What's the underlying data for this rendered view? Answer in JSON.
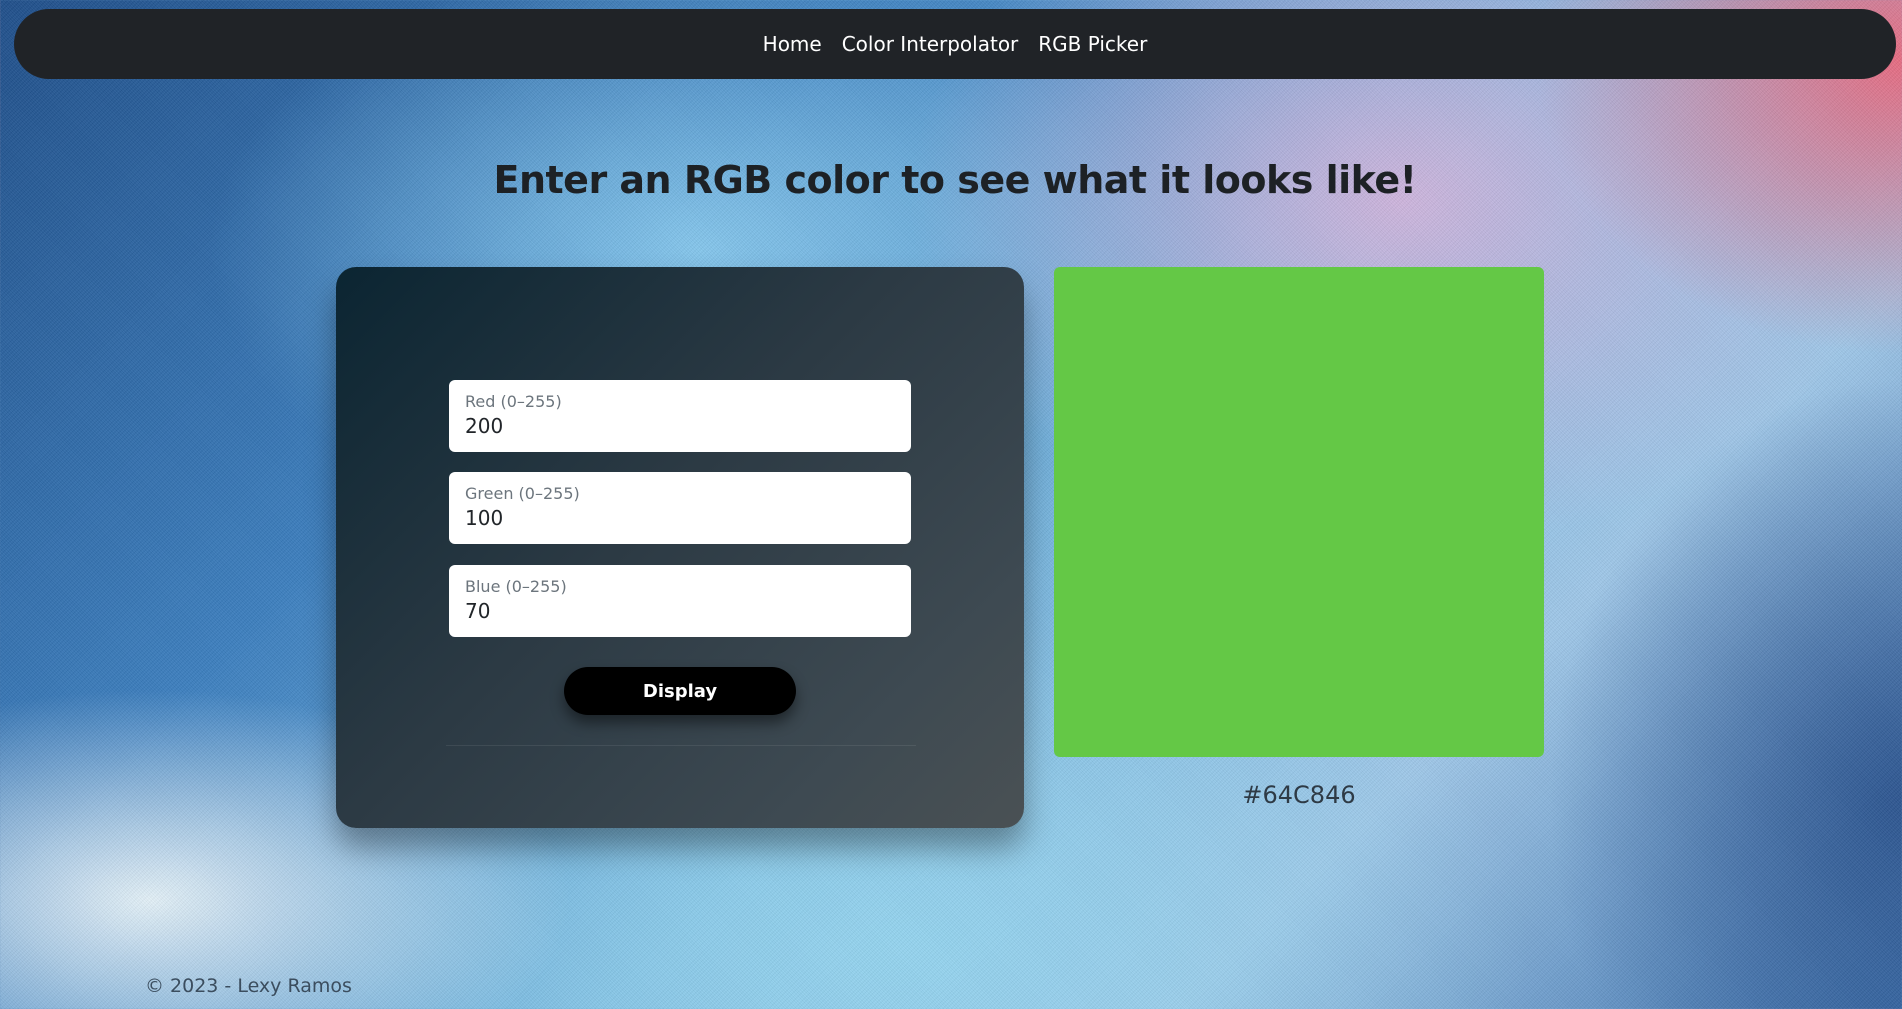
{
  "nav": {
    "links": [
      "Home",
      "Color Interpolator",
      "RGB Picker"
    ]
  },
  "main": {
    "heading": "Enter an RGB color to see what it looks like!"
  },
  "form": {
    "red": {
      "label": "Red (0–255)",
      "value": "200"
    },
    "green": {
      "label": "Green (0–255)",
      "value": "100"
    },
    "blue": {
      "label": "Blue (0–255)",
      "value": "70"
    },
    "button_label": "Display"
  },
  "preview": {
    "swatch_color": "#64C846",
    "hex_text": "#64C846"
  },
  "footer": {
    "copyright": "© 2023 - Lexy Ramos"
  }
}
